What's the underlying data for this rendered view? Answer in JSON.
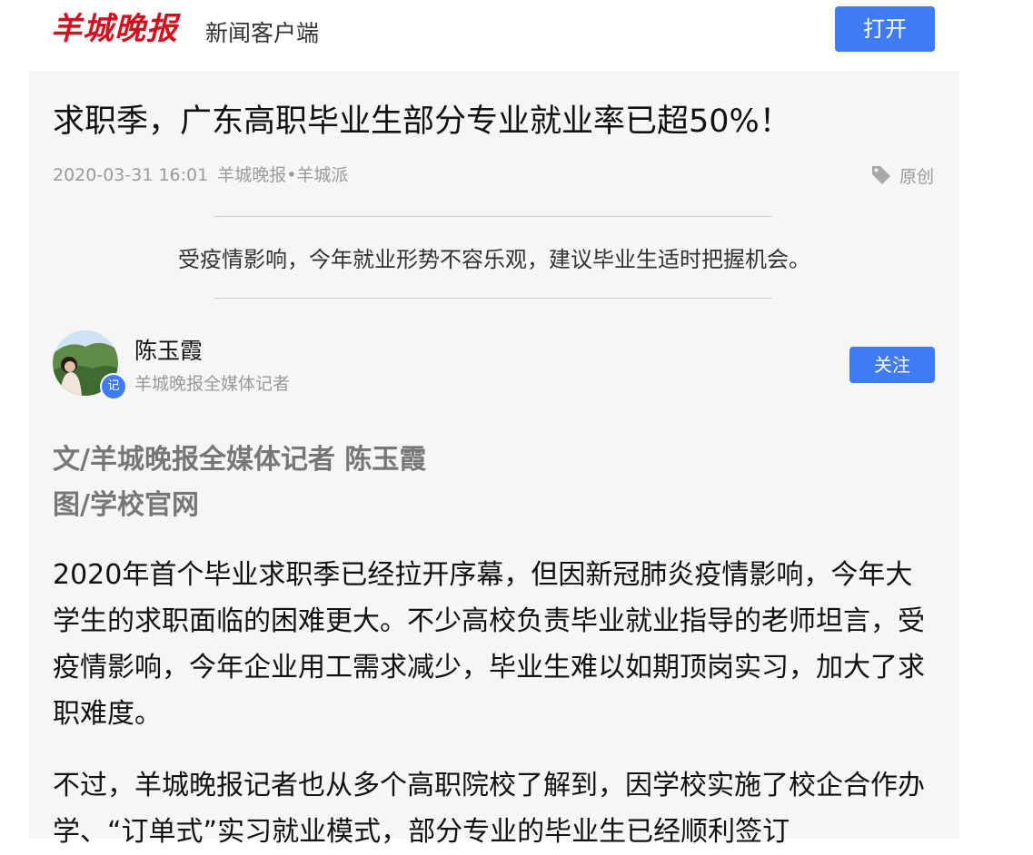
{
  "header": {
    "logo_text": "羊城晚报",
    "app_label": "新闻客户端",
    "open_label": "打开",
    "brand_color": "#d4101e",
    "accent_color": "#3f7bf5"
  },
  "article": {
    "title": "求职季，广东高职毕业生部分专业就业率已超50%！",
    "date": "2020-03-31 16:01",
    "source": "羊城晚报•羊城派",
    "tag_icon": "tag-icon",
    "tag_label": "原创",
    "summary": "受疫情影响，今年就业形势不容乐观，建议毕业生适时把握机会。",
    "author": {
      "name": "陈玉霞",
      "role": "羊城晚报全媒体记者",
      "badge": "记",
      "follow_label": "关注"
    },
    "byline_line1": "文/羊城晚报全媒体记者 陈玉霞",
    "byline_line2": "图/学校官网",
    "paragraphs": [
      "2020年首个毕业求职季已经拉开序幕，但因新冠肺炎疫情影响，今年大学生的求职面临的困难更大。不少高校负责毕业就业指导的老师坦言，受疫情影响，今年企业用工需求减少，毕业生难以如期顶岗实习，加大了求职难度。",
      "不过，羊城晚报记者也从多个高职院校了解到，因学校实施了校企合作办学、“订单式”实习就业模式，部分专业的毕业生已经顺利签订"
    ]
  }
}
